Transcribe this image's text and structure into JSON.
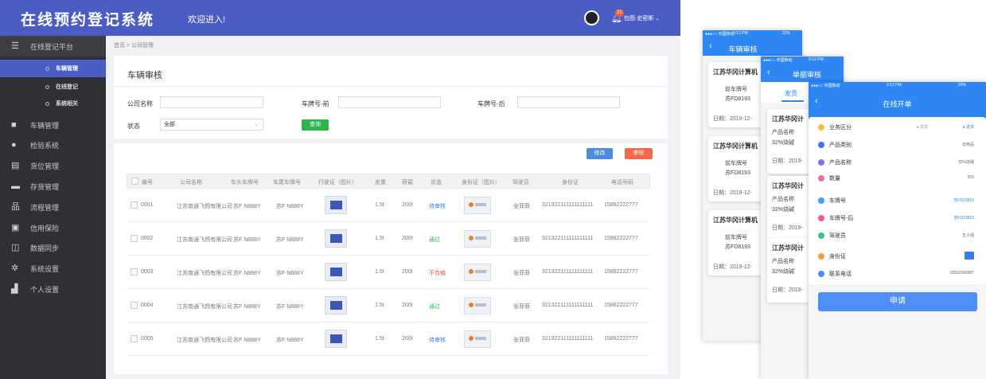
{
  "header": {
    "title": "在线预约登记系统",
    "welcome": "欢迎进入!",
    "badge": "21",
    "user": "包图·史密斯"
  },
  "sidebar": {
    "platform": "在线登记平台",
    "subs": [
      "车辆管理",
      "在线登记",
      "系统相关"
    ],
    "items": [
      "车辆管理",
      "检验系统",
      "货位管理",
      "存货管理",
      "流程管理",
      "信用保险",
      "数据同步",
      "系统设置",
      "个人设置"
    ]
  },
  "breadcrumb": "首页 > 公司管理",
  "filters": {
    "title": "车辆审核",
    "company_label": "公司名称",
    "plate_front_label": "车牌号-前",
    "plate_back_label": "车牌号-后",
    "status_label": "状态",
    "status_value": "全部",
    "search_label": "查询"
  },
  "actions": {
    "edit": "修改",
    "audit": "审核"
  },
  "table": {
    "headers": [
      "编号",
      "公司名称",
      "车头车牌号",
      "车尾车牌号",
      "行驶证（图片）",
      "皮重",
      "荷载",
      "状态",
      "身份证（图片）",
      "驾驶员",
      "身份证",
      "电话号码"
    ],
    "rows": [
      {
        "id": "0001",
        "company": "江苏南通飞鸽有限公司",
        "front": "苏F N888Y",
        "back": "苏F N888Y",
        "tare": "1.5t",
        "load": "200t",
        "status": "待审核",
        "driver": "张菲菲",
        "idno": "321322111111111111",
        "phone": "15862222777"
      },
      {
        "id": "0002",
        "company": "江苏南通飞鸽有限公司",
        "front": "苏F N888Y",
        "back": "苏F N888Y",
        "tare": "1.5t",
        "load": "200t",
        "status": "通过",
        "driver": "张菲菲",
        "idno": "321322111111111111",
        "phone": "15862222777"
      },
      {
        "id": "0003",
        "company": "江苏南通飞鸽有限公司",
        "front": "苏F N888Y",
        "back": "苏F N888Y",
        "tare": "1.5t",
        "load": "200t",
        "status": "不合格",
        "driver": "张菲菲",
        "idno": "321322111111111111",
        "phone": "15862222777"
      },
      {
        "id": "0004",
        "company": "江苏南通飞鸽有限公司",
        "front": "苏F N888Y",
        "back": "苏F N888Y",
        "tare": "1.5t",
        "load": "200t",
        "status": "通过",
        "driver": "张菲菲",
        "idno": "321322111111111111",
        "phone": "15862222777"
      },
      {
        "id": "0005",
        "company": "江苏南通飞鸽有限公司",
        "front": "苏F N888Y",
        "back": "苏F N888Y",
        "tare": "1.5t",
        "load": "200t",
        "status": "待审核",
        "driver": "张菲菲",
        "idno": "321322111111111111",
        "phone": "15862222777"
      }
    ],
    "status_colors": {
      "待审核": "#3b7be0",
      "通过": "#2bb54a",
      "不合格": "#f04a3a"
    }
  },
  "phone1": {
    "carrier": "●●●○○ 中国移动",
    "time": "9:12 PM",
    "battery": "22%",
    "title": "车辆审核",
    "filter": "筛选",
    "cards": [
      {
        "company": "江苏华冈计算机",
        "plate_label": "前车牌号",
        "plate": "苏FD8193",
        "date": "日期：2019-12-"
      },
      {
        "company": "江苏华冈计算机",
        "plate_label": "前车牌号",
        "plate": "苏FD8193",
        "date": "日期：2019-12-"
      },
      {
        "company": "江苏华冈计算机",
        "plate_label": "前车牌号",
        "plate": "苏FD8193",
        "date": "日期：2019-12-"
      }
    ]
  },
  "phone2": {
    "carrier": "●●●○○ 中国移动",
    "time": "9:12 PM",
    "battery": "22%",
    "title": "单据审核",
    "filter": "筛选",
    "tab": "发货",
    "cards": [
      {
        "company": "江苏华冈计",
        "label": "产品名称",
        "value": "32%烧碱",
        "date": "日期：2019-"
      },
      {
        "company": "江苏华冈计",
        "label": "产品名称",
        "value": "32%烧碱",
        "date": "日期：2019-"
      },
      {
        "company": "江苏华冈计",
        "label": "产品名称",
        "value": "32%烧碱",
        "date": "日期：2019-"
      }
    ]
  },
  "phone3": {
    "carrier": "●●●○○ 中国移动",
    "time": "9:12 PM",
    "battery": "22%",
    "title": "在线开单",
    "biz_label": "业务区分",
    "biz_opt1": "发货",
    "biz_opt2": "进货",
    "fields": [
      {
        "label": "产品类别",
        "value": "日用品",
        "color": "#4a6cf0"
      },
      {
        "label": "产品名称",
        "value": "32%烧碱",
        "color": "#8a6cf0"
      },
      {
        "label": "数量",
        "value": "555",
        "color": "#f06ab0"
      },
      {
        "label": "车牌号",
        "value": "苏FD23823",
        "color": "#3fa0f5"
      },
      {
        "label": "车牌号-后",
        "value": "苏FD23823",
        "color": "#f05a8a"
      },
      {
        "label": "驾驶员",
        "value": "五小强",
        "color": "#38c08a"
      },
      {
        "label": "身份证",
        "value": "",
        "color": "#f0a03a"
      },
      {
        "label": "联系电话",
        "value": "18552366987",
        "color": "#4a8cf0"
      }
    ],
    "apply": "申请"
  }
}
